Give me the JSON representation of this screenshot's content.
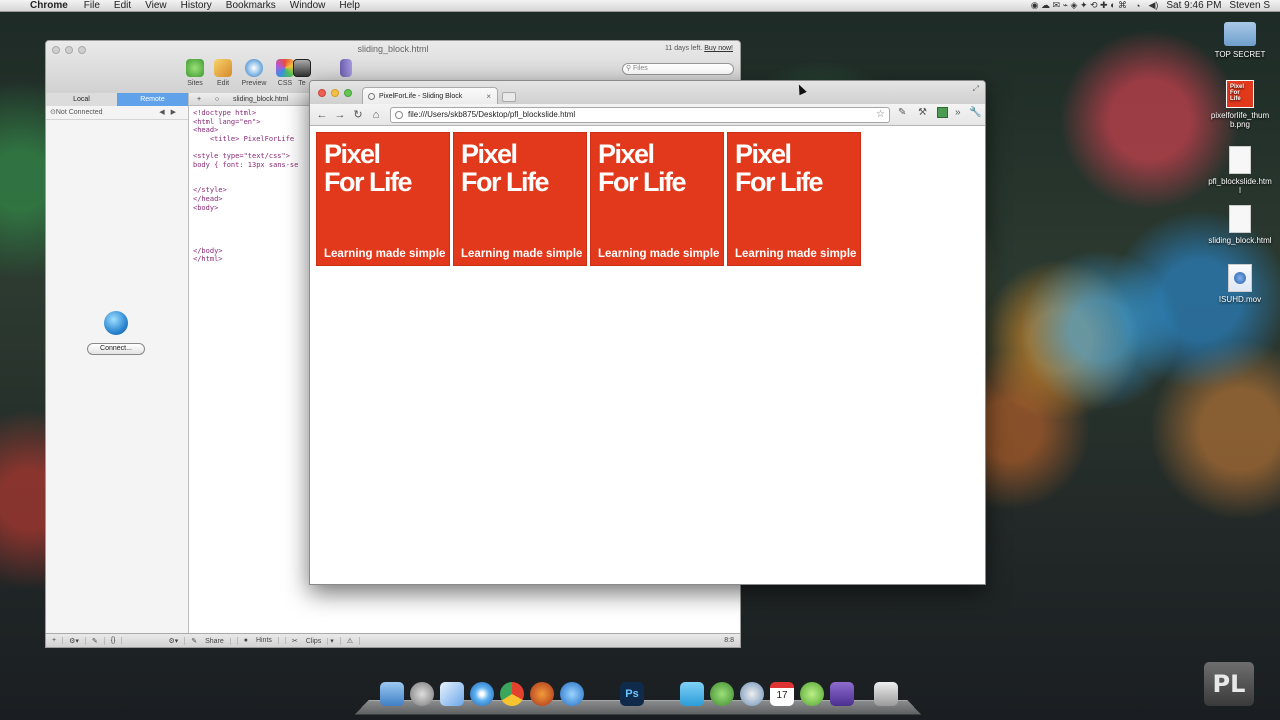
{
  "menubar": {
    "app": "Chrome",
    "items": [
      "File",
      "Edit",
      "View",
      "History",
      "Bookmarks",
      "Window",
      "Help"
    ],
    "clock": "Sat 9:46 PM",
    "user": "Steven S"
  },
  "editor": {
    "window_title": "sliding_block.html",
    "trial": "11 days left.",
    "buy": "Buy now!",
    "toolbar": [
      "Sites",
      "Edit",
      "Preview",
      "CSS",
      "Te"
    ],
    "search_placeholder": "Files",
    "sidebar": {
      "tab_local": "Local",
      "tab_remote": "Remote",
      "status": "Not Connected",
      "connect": "Connect..."
    },
    "tab_name": "sliding_block.html",
    "code": "<!doctype html>\n<html lang=\"en\">\n<head>\n    <title> PixelForLife\n\n<style type=\"text/css\">\nbody { font: 13px sans-se\n\n\n</style>\n</head>\n<body>\n\n\n\n\n</body>\n</html>",
    "status": {
      "share": "Share",
      "hints": "Hints",
      "clips": "Clips",
      "pos": "8:8"
    }
  },
  "chrome": {
    "tab_title": "PixelForLife - Sliding Block",
    "url": "file:///Users/skb875/Desktop/pfl_blockslide.html",
    "blocks": [
      {
        "line1": "Pixel",
        "line2": "For Life",
        "tagline": "Learning made simple"
      },
      {
        "line1": "Pixel",
        "line2": "For Life",
        "tagline": "Learning made simple"
      },
      {
        "line1": "Pixel",
        "line2": "For Life",
        "tagline": "Learning made simple"
      },
      {
        "line1": "Pixel",
        "line2": "For Life",
        "tagline": "Learning made simple"
      }
    ],
    "block_color": "#e2391c"
  },
  "desktop": {
    "icons": [
      {
        "label": "TOP SECRET",
        "kind": "folder"
      },
      {
        "label": "pixelforlife_thumb.png",
        "kind": "image"
      },
      {
        "label": "pfl_blockslide.html",
        "kind": "html"
      },
      {
        "label": "sliding_block.html",
        "kind": "html"
      },
      {
        "label": "ISUHD.mov",
        "kind": "movie"
      }
    ],
    "thumb_text": "Pixel For Life",
    "watermark": "PL"
  }
}
